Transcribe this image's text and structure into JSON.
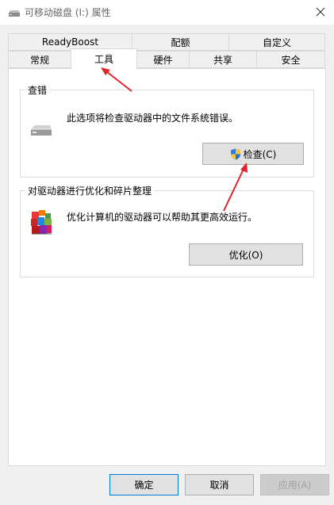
{
  "window": {
    "title": "可移动磁盘 (I:) 属性",
    "icon": "drive-icon",
    "close_icon": "close-icon"
  },
  "tabs": {
    "row1": [
      {
        "label": "ReadyBoost"
      },
      {
        "label": "配额"
      },
      {
        "label": "自定义"
      }
    ],
    "row2": [
      {
        "label": "常规"
      },
      {
        "label": "工具"
      },
      {
        "label": "硬件"
      },
      {
        "label": "共享"
      },
      {
        "label": "安全"
      }
    ],
    "active": "工具"
  },
  "error_check": {
    "title": "查错",
    "description": "此选项将检查驱动器中的文件系统错误。",
    "button_label": "检查(C)",
    "button_icon": "shield-icon",
    "icon": "drive-icon"
  },
  "optimize": {
    "title": "对驱动器进行优化和碎片整理",
    "description": "优化计算机的驱动器可以帮助其更高效运行。",
    "button_label": "优化(O)",
    "icon": "defrag-icon"
  },
  "footer": {
    "ok_label": "确定",
    "cancel_label": "取消",
    "apply_label": "应用(A)"
  },
  "colors": {
    "accent": "#0078d7",
    "annotation_arrow": "#e0242b"
  }
}
